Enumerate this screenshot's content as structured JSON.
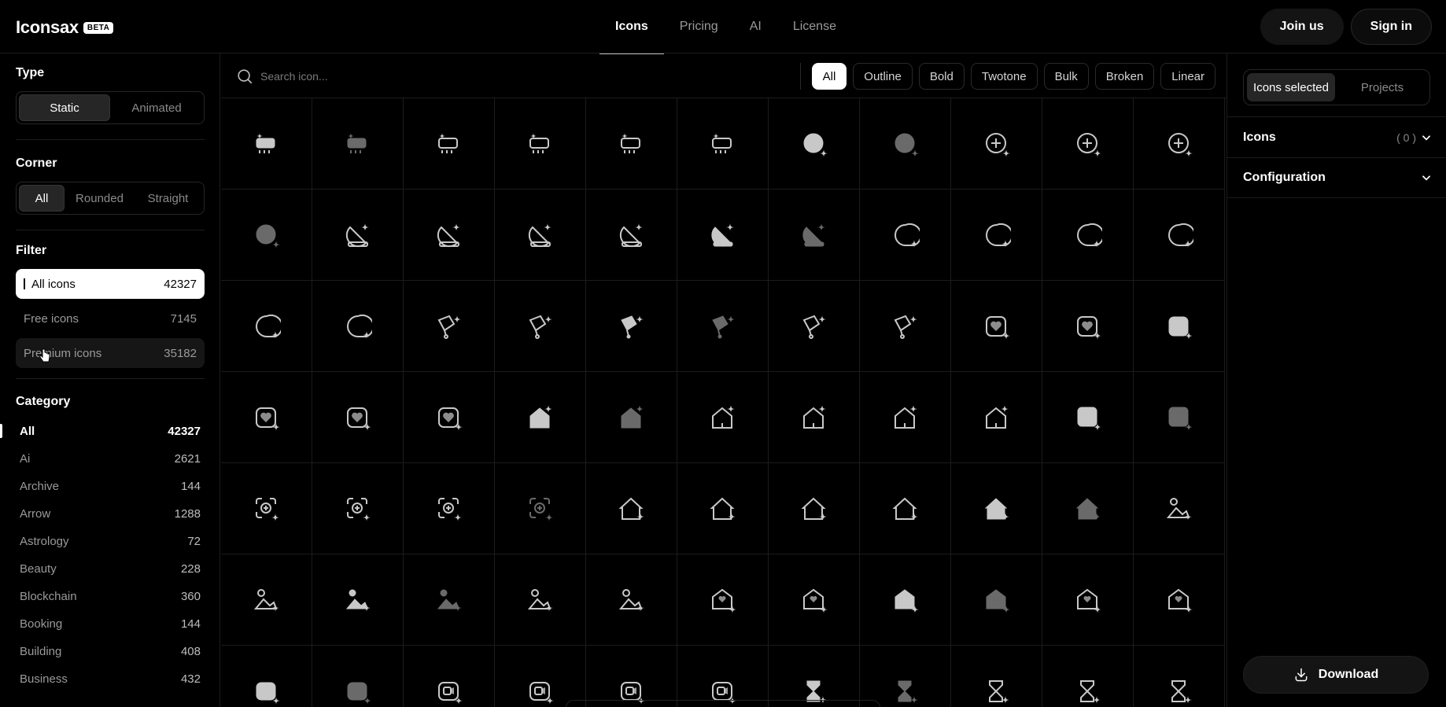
{
  "brand": {
    "name": "Iconsax",
    "badge": "BETA"
  },
  "nav": {
    "items": [
      "Icons",
      "Pricing",
      "AI",
      "License"
    ],
    "active": "Icons"
  },
  "header_actions": {
    "join": "Join us",
    "signin": "Sign in"
  },
  "sidebar": {
    "type": {
      "title": "Type",
      "options": [
        "Static",
        "Animated"
      ],
      "active": "Static"
    },
    "corner": {
      "title": "Corner",
      "options": [
        "All",
        "Rounded",
        "Straight"
      ],
      "active": "All"
    },
    "filter": {
      "title": "Filter",
      "items": [
        {
          "label": "All icons",
          "count": "42327"
        },
        {
          "label": "Free icons",
          "count": "7145"
        },
        {
          "label": "Premium icons",
          "count": "35182"
        }
      ]
    },
    "category": {
      "title": "Category",
      "items": [
        {
          "label": "All",
          "count": "42327"
        },
        {
          "label": "Ai",
          "count": "2621"
        },
        {
          "label": "Archive",
          "count": "144"
        },
        {
          "label": "Arrow",
          "count": "1288"
        },
        {
          "label": "Astrology",
          "count": "72"
        },
        {
          "label": "Beauty",
          "count": "228"
        },
        {
          "label": "Blockchain",
          "count": "360"
        },
        {
          "label": "Booking",
          "count": "144"
        },
        {
          "label": "Building",
          "count": "408"
        },
        {
          "label": "Business",
          "count": "432"
        }
      ]
    }
  },
  "search": {
    "placeholder": "Search icon..."
  },
  "styles": {
    "items": [
      "All",
      "Outline",
      "Bold",
      "Twotone",
      "Bulk",
      "Broken",
      "Linear"
    ],
    "active": "All"
  },
  "icon_grid": {
    "rows": [
      [
        "projector-ai-icon",
        "projector-ai-icon",
        "projector-ai-icon",
        "projector-ai-icon",
        "projector-ai-icon",
        "projector-ai-icon",
        "add-circle-ai-icon",
        "add-circle-ai-icon",
        "add-circle-ai-icon",
        "add-circle-ai-icon",
        "add-circle-ai-icon"
      ],
      [
        "add-circle-ai-icon",
        "satellite-dish-ai-icon",
        "satellite-dish-ai-icon",
        "satellite-dish-ai-icon",
        "satellite-dish-ai-icon",
        "satellite-dish-ai-icon",
        "satellite-dish-ai-icon",
        "chat-bubble-ai-icon",
        "chat-bubble-ai-icon",
        "chat-bubble-ai-icon",
        "chat-bubble-ai-icon"
      ],
      [
        "chat-bubble-ai-icon",
        "chat-bubble-ai-icon",
        "stethoscope-ai-icon",
        "stethoscope-ai-icon",
        "stethoscope-ai-icon",
        "stethoscope-ai-icon",
        "stethoscope-ai-icon",
        "stethoscope-ai-icon",
        "heart-square-ai-icon",
        "heart-square-ai-icon",
        "heart-square-ai-icon"
      ],
      [
        "heart-square-ai-icon",
        "heart-square-ai-icon",
        "heart-square-ai-icon",
        "home-ai-icon",
        "home-ai-icon",
        "home-ai-icon",
        "home-ai-icon",
        "home-ai-icon",
        "home-ai-icon",
        "medical-box-ai-icon",
        "medical-box-ai-icon"
      ],
      [
        "scan-plus-ai-icon",
        "scan-plus-ai-icon",
        "scan-plus-ai-icon",
        "scan-plus-ai-icon",
        "house-ai-icon",
        "house-ai-icon",
        "house-ai-icon",
        "house-ai-icon",
        "house-ai-icon",
        "house-ai-icon",
        "image-ai-icon"
      ],
      [
        "image-ai-icon",
        "image-ai-icon",
        "image-ai-icon",
        "image-ai-icon",
        "image-ai-icon",
        "mail-heart-ai-icon",
        "mail-heart-ai-icon",
        "mail-heart-ai-icon",
        "mail-heart-ai-icon",
        "mail-heart-ai-icon",
        "mail-heart-ai-icon"
      ],
      [
        "video-ai-icon",
        "video-ai-icon",
        "video-ai-icon",
        "video-ai-icon",
        "video-ai-icon",
        "video-ai-icon",
        "hourglass-ai-icon",
        "hourglass-ai-icon",
        "hourglass-ai-icon",
        "hourglass-ai-icon",
        "hourglass-ai-icon"
      ]
    ]
  },
  "right_panel": {
    "tabs": [
      "Icons selected",
      "Projects"
    ],
    "active_tab": "Icons selected",
    "icons_section": {
      "title": "Icons",
      "count": "( 0 )"
    },
    "config_section": {
      "title": "Configuration"
    },
    "download": "Download"
  }
}
